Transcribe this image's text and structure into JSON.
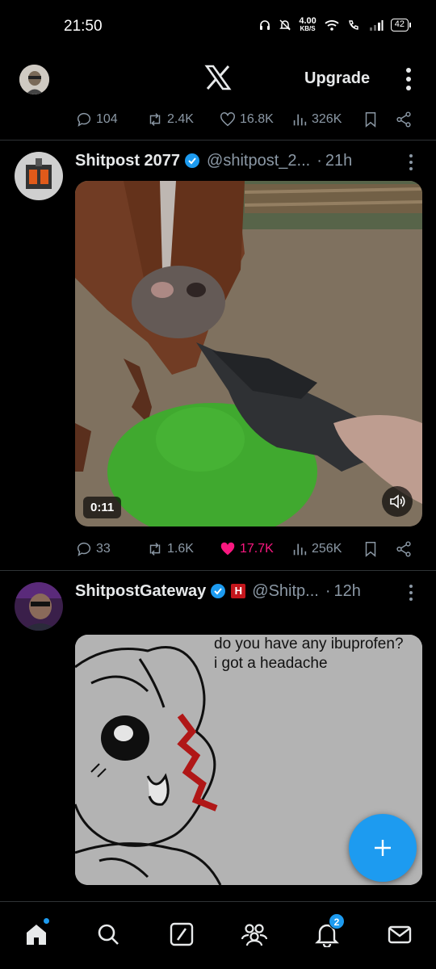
{
  "status_bar": {
    "time": "21:50",
    "net_speed_value": "4.00",
    "net_speed_unit": "KB/S",
    "battery": "42"
  },
  "header": {
    "logo": "x-logo",
    "upgrade_label": "Upgrade"
  },
  "top_actions": {
    "replies": "104",
    "reposts": "2.4K",
    "likes": "16.8K",
    "views": "326K"
  },
  "tweets": [
    {
      "display_name": "Shitpost 2077",
      "handle": "@shitpost_2...",
      "separator": "·",
      "time": "21h",
      "video_duration": "0:11",
      "replies": "33",
      "reposts": "1.6K",
      "likes": "17.7K",
      "views": "256K",
      "liked": true
    },
    {
      "display_name": "ShitpostGateway",
      "badge": "H",
      "handle": "@Shitp...",
      "separator": "·",
      "time": "12h",
      "meme_text_line1": "do you have any ibuprofen?",
      "meme_text_line2": "i got a headache"
    }
  ],
  "bottom_nav": {
    "notifications_badge": "2"
  },
  "colors": {
    "accent": "#1d9bf0",
    "like": "#f91880",
    "muted": "#8b98a5",
    "background": "#000000"
  }
}
